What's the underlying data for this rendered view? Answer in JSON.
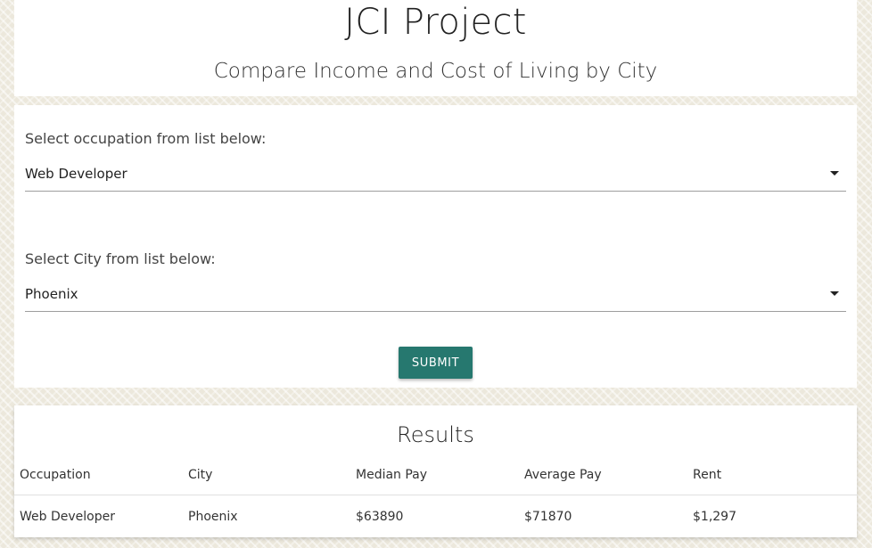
{
  "header": {
    "title": "JCI Project",
    "subtitle": "Compare Income and Cost of Living by City"
  },
  "form": {
    "occupation_label": "Select occupation from list below:",
    "occupation_value": "Web Developer",
    "city_label": "Select City from list below:",
    "city_value": "Phoenix",
    "submit_label": "SUBMIT"
  },
  "results": {
    "title": "Results",
    "columns": [
      "Occupation",
      "City",
      "Median Pay",
      "Average Pay",
      "Rent"
    ],
    "rows": [
      [
        "Web Developer",
        "Phoenix",
        "$63890",
        "$71870",
        "$1,297"
      ]
    ]
  },
  "colors": {
    "accent": "#26786f",
    "background": "#ece8dc"
  },
  "icons": {
    "dropdown": "caret-down-icon"
  }
}
